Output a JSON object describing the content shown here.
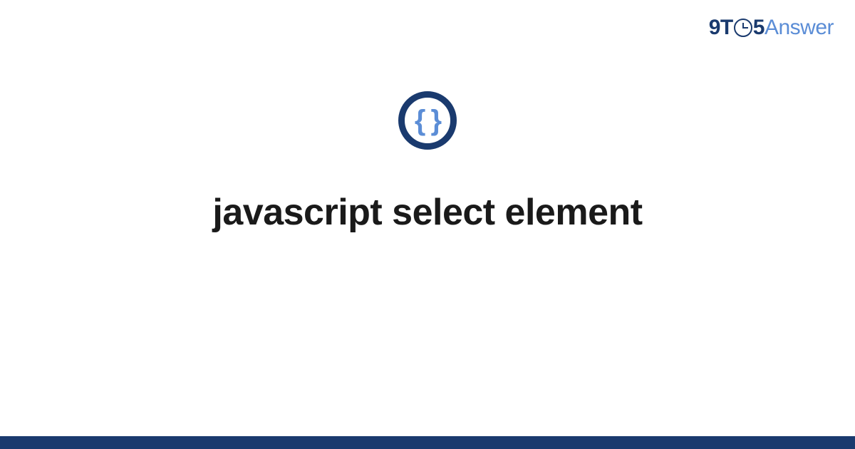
{
  "logo": {
    "part1": "9T",
    "part2": "5",
    "part3": "Answer"
  },
  "icon": {
    "braces": "{ }"
  },
  "title": "javascript select element",
  "colors": {
    "dark_blue": "#1a3a6e",
    "light_blue": "#5b8dd6",
    "text": "#1a1a1a"
  }
}
